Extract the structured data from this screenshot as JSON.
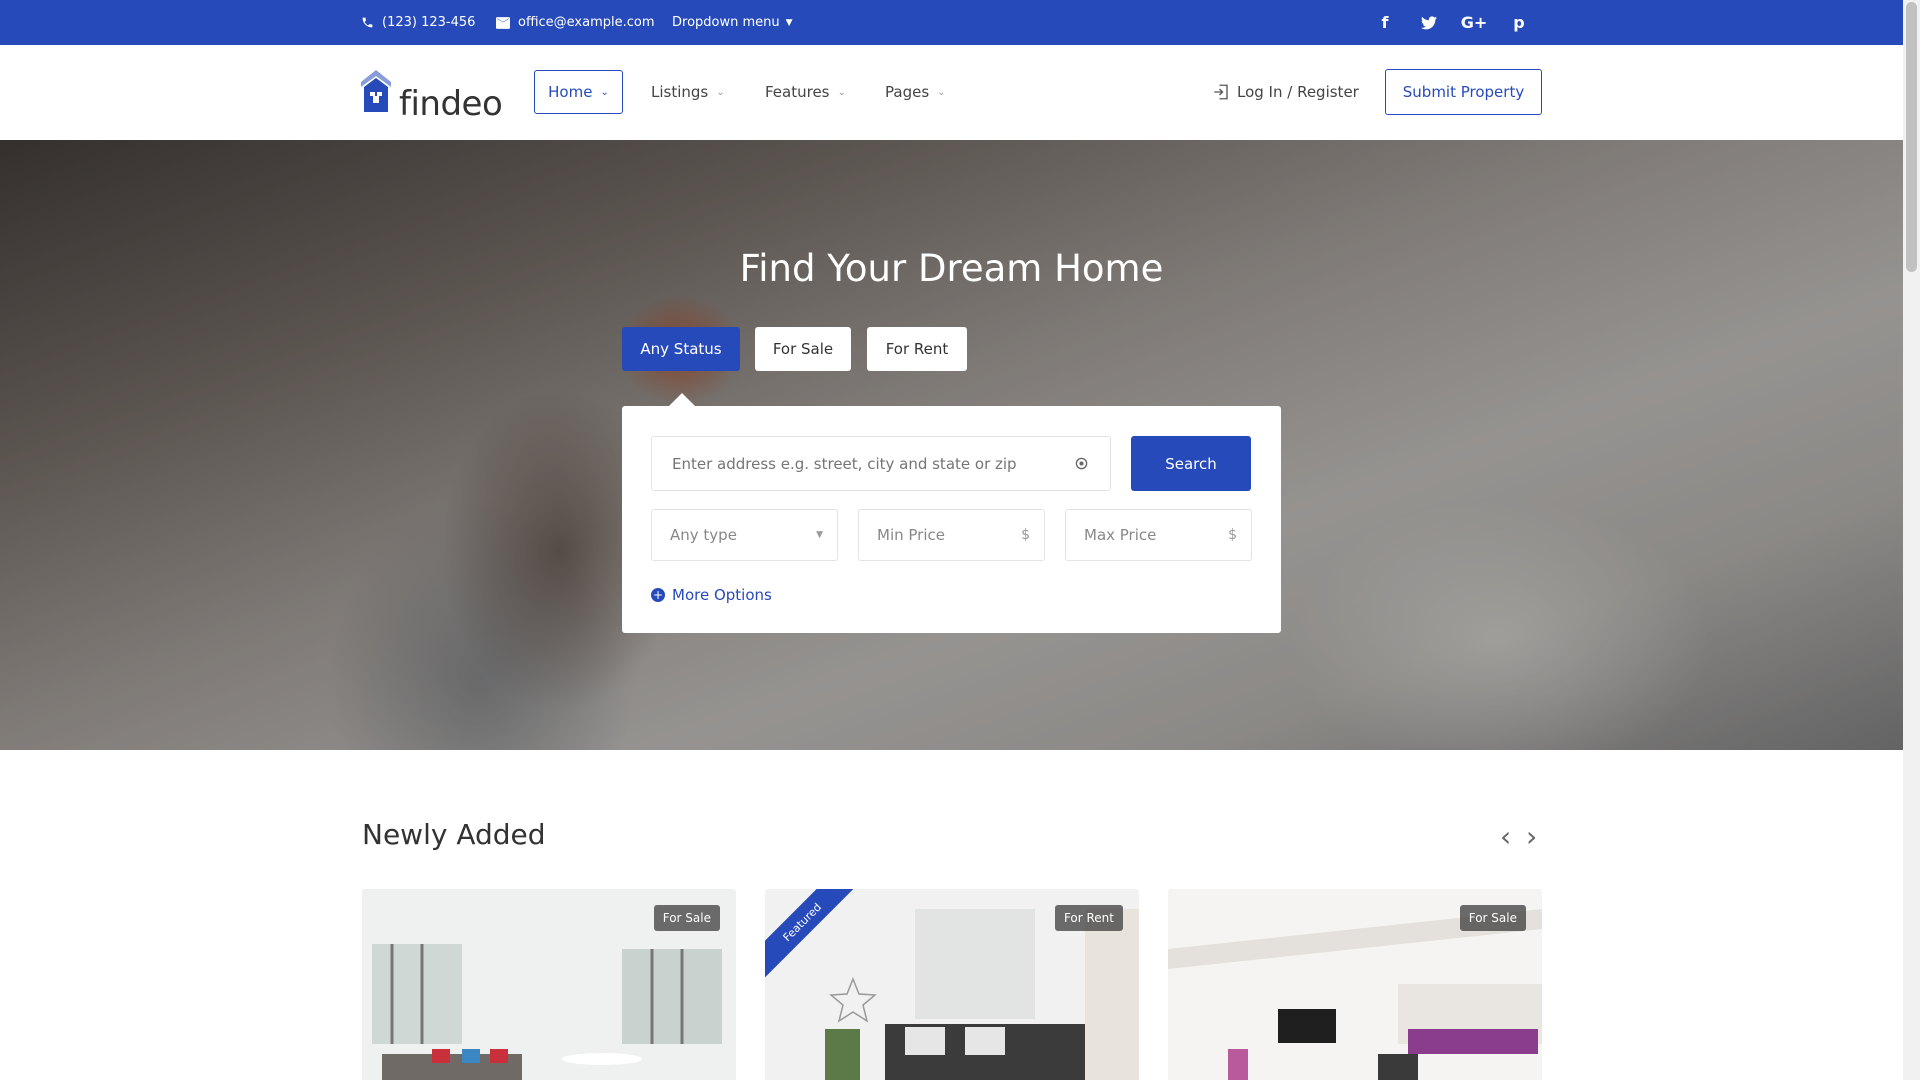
{
  "topbar": {
    "phone": "(123) 123-456",
    "email": "office@example.com",
    "dropdown": "Dropdown menu",
    "social": [
      "facebook-icon",
      "twitter-icon",
      "google-plus-icon",
      "pinterest-icon"
    ]
  },
  "header": {
    "logo_text": "findeo",
    "nav": [
      {
        "label": "Home",
        "active": true
      },
      {
        "label": "Listings"
      },
      {
        "label": "Features"
      },
      {
        "label": "Pages"
      }
    ],
    "login_label": "Log In / Register",
    "submit_label": "Submit Property"
  },
  "hero": {
    "title": "Find Your Dream Home",
    "tabs": [
      "Any Status",
      "For Sale",
      "For Rent"
    ],
    "address_placeholder": "Enter address e.g. street, city and state or zip",
    "search_label": "Search",
    "type_placeholder": "Any type",
    "min_price": "Min Price",
    "max_price": "Max Price",
    "currency": "$",
    "more_options": "More Options"
  },
  "listings": {
    "title": "Newly Added",
    "cards": [
      {
        "badge": "For Sale",
        "featured": false
      },
      {
        "badge": "For Rent",
        "featured": true,
        "featured_label": "Featured"
      },
      {
        "badge": "For Sale",
        "featured": false
      }
    ]
  },
  "colors": {
    "brand": "#274abb"
  }
}
